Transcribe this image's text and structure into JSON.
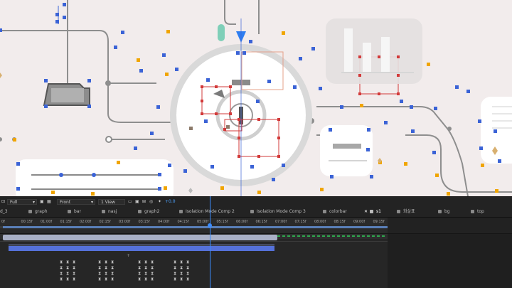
{
  "viewer": {
    "bg": "#f2ecec",
    "handle_blue": "#3b63d6",
    "handle_orange": "#f0a500",
    "handle_red": "#d23a3a"
  },
  "viewer_bar": {
    "resolution": "Full",
    "camera": "Front",
    "views": "1 View",
    "exposure": "+0.0"
  },
  "comp_tabs": [
    {
      "label": "d_3"
    },
    {
      "label": "graph"
    },
    {
      "label": "bar"
    },
    {
      "label": "nasj"
    },
    {
      "label": "graph2"
    },
    {
      "label": "Isolation Mode Comp 2"
    },
    {
      "label": "Isolation Mode Comp 3"
    },
    {
      "label": "colorbar"
    },
    {
      "label": "s1"
    },
    {
      "label": "화살표"
    },
    {
      "label": "bg"
    },
    {
      "label": "top"
    }
  ],
  "ruler": {
    "ticks": [
      "0f",
      "00:15f",
      "01:00f",
      "01:15f",
      "02:00f",
      "02:15f",
      "03:00f",
      "03:15f",
      "04:00f",
      "04:15f",
      "05:00f",
      "05:15f",
      "06:00f",
      "06:15f",
      "07:00f",
      "07:15f",
      "08:00f",
      "08:15f",
      "09:00f",
      "09:15f",
      "10:00f",
      "10:15f",
      "11:00f",
      "11:15f",
      "12:00f",
      "12:15f"
    ]
  },
  "icons": {
    "resolution_dropdown": "chevron-down-icon",
    "camera_dropdown": "chevron-down-icon",
    "grid_toggle": "grid-icon",
    "snapshot": "camera-icon",
    "color_channel": "rgb-icon",
    "exposure": "exposure-icon",
    "playhead": "playhead-icon"
  }
}
